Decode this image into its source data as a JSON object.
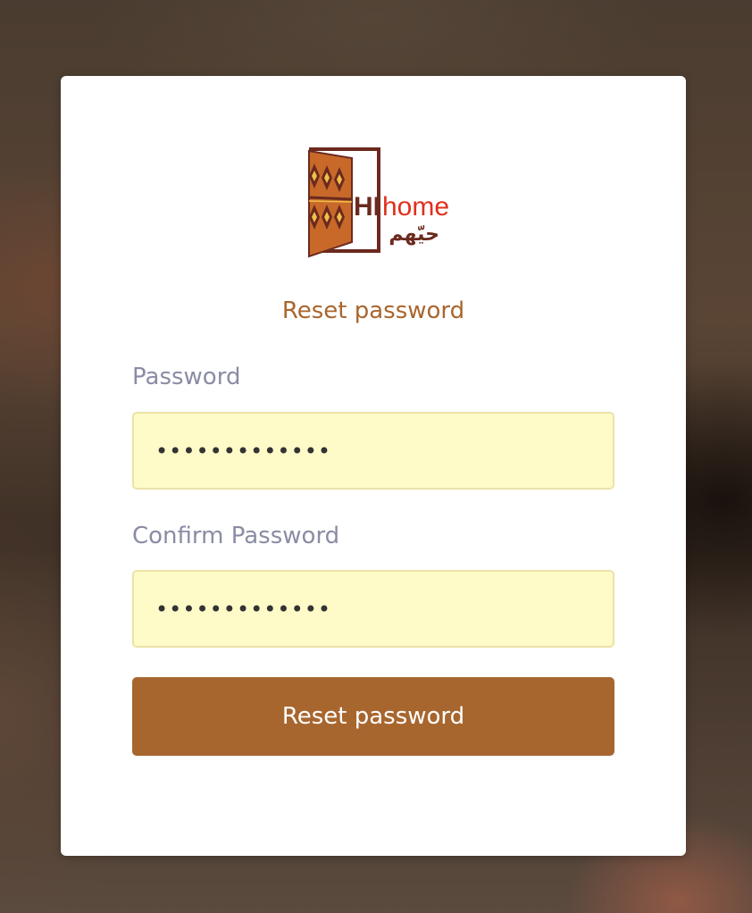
{
  "brand": {
    "name_latin_hi": "HI",
    "name_latin_home": "home",
    "name_arabic": "حيّهم",
    "colors": {
      "frame": "#6b2a1e",
      "door": "#c8692a",
      "red": "#e0301e"
    }
  },
  "form": {
    "title": "Reset password",
    "password_label": "Password",
    "password_value": "•••••••••••••",
    "confirm_label": "Confirm Password",
    "confirm_value": "•••••••••••••",
    "submit_label": "Reset password"
  },
  "colors": {
    "accent": "#a8662f",
    "input_bg": "#fefbc8",
    "label": "#8a8ca5"
  }
}
